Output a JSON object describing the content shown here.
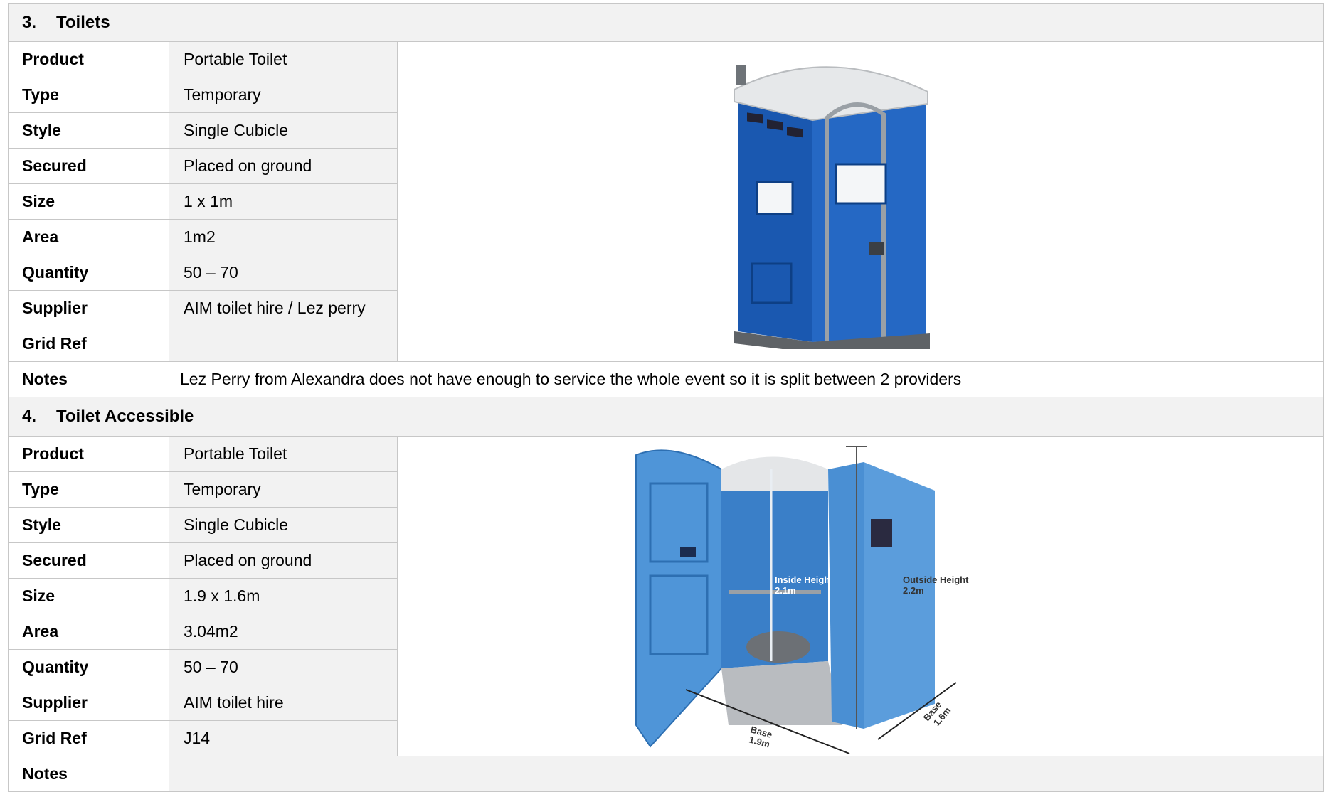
{
  "sections": [
    {
      "number": "3.",
      "title": "Toilets",
      "rows": [
        {
          "label": "Product",
          "value": "Portable Toilet"
        },
        {
          "label": "Type",
          "value": "Temporary"
        },
        {
          "label": "Style",
          "value": "Single Cubicle"
        },
        {
          "label": "Secured",
          "value": "Placed on ground"
        },
        {
          "label": "Size",
          "value": "1 x 1m"
        },
        {
          "label": "Area",
          "value": "1m2"
        },
        {
          "label": "Quantity",
          "value": "50 – 70"
        },
        {
          "label": "Supplier",
          "value": "AIM toilet hire / Lez perry"
        },
        {
          "label": "Grid Ref",
          "value": ""
        }
      ],
      "notes_label": "Notes",
      "notes": "Lez Perry from Alexandra does not have enough to service the whole event so it is split between 2 providers",
      "image_subject": "blue-portable-toilet-photo"
    },
    {
      "number": "4.",
      "title": "Toilet Accessible",
      "rows": [
        {
          "label": "Product",
          "value": "Portable Toilet"
        },
        {
          "label": "Type",
          "value": "Temporary"
        },
        {
          "label": "Style",
          "value": "Single Cubicle"
        },
        {
          "label": "Secured",
          "value": "Placed on ground"
        },
        {
          "label": "Size",
          "value": "1.9 x 1.6m"
        },
        {
          "label": "Area",
          "value": "3.04m2"
        },
        {
          "label": "Quantity",
          "value": "50 – 70"
        },
        {
          "label": "Supplier",
          "value": "AIM toilet hire"
        },
        {
          "label": "Grid Ref",
          "value": "J14"
        }
      ],
      "notes_label": "Notes",
      "notes": "",
      "image_subject": "accessible-portable-toilet-photo",
      "image_annotations": {
        "inside_height_label": "Inside Height",
        "inside_height_value": "2.1m",
        "outside_height_label": "Outside Height",
        "outside_height_value": "2.2m",
        "base_width_label": "Base",
        "base_width_value": "1.9m",
        "base_depth_label": "Base",
        "base_depth_value": "1.6m"
      }
    }
  ],
  "colors": {
    "toilet_blue": "#1f5fb8",
    "accessible_blue": "#4f95d8",
    "roof_grey": "#e6e8ea",
    "shaded_cell": "#f2f2f2",
    "border": "#c7c7c7"
  }
}
